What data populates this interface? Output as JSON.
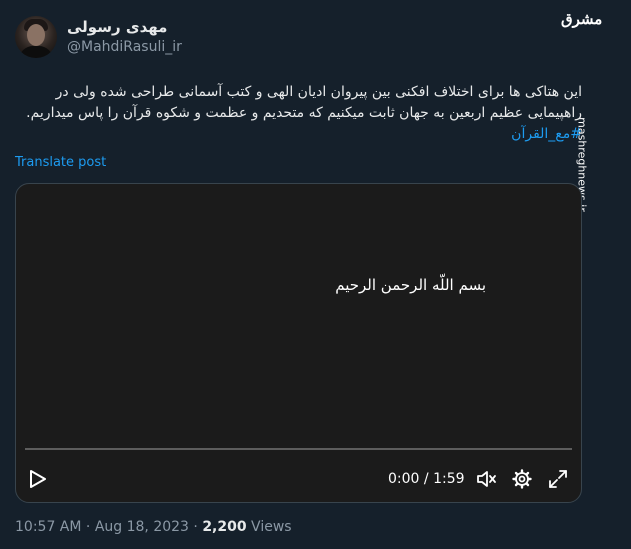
{
  "author": {
    "display_name": "مهدی رسولی",
    "handle": "@MahdiRasuli_ir"
  },
  "watermark": {
    "logo_text": "مشرق",
    "url": "mashreghnews.ir"
  },
  "tweet": {
    "text": "این هتاکی ها برای اختلاف افکنی بین پیروان ادیان الهی و کتب آسمانی طراحی شده ولی در راهپیمایی عظیم اربعین به جهان ثابت میکنیم که متحدیم و عظمت و شکوه قرآن را پاس میداریم.",
    "hashtag": "#مع_القرآن",
    "translate_label": "Translate post"
  },
  "video": {
    "caption": "بسم اللّه الرحمن الرحیم",
    "current_time": "0:00",
    "duration": "1:59",
    "time_separator": " / ",
    "progress_fraction": 0.0
  },
  "meta": {
    "time": "10:57 AM",
    "date": "Aug 18, 2023",
    "separator": " · ",
    "views_count": "2,200",
    "views_label": " Views"
  },
  "colors": {
    "background": "#15202b",
    "accent": "#1d9bf0",
    "secondary_text": "#8b98a5"
  },
  "icons": [
    "play-icon",
    "volume-icon",
    "gear-icon",
    "fullscreen-icon"
  ]
}
